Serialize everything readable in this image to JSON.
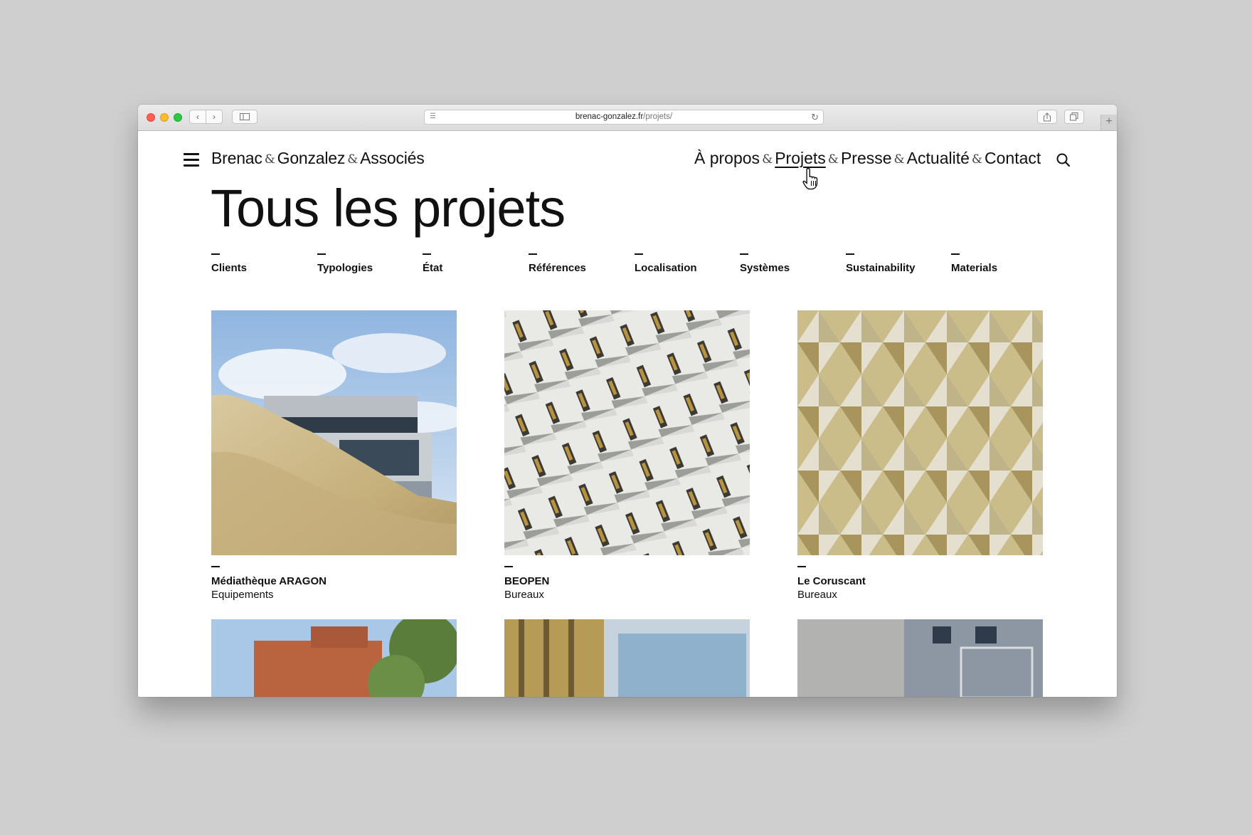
{
  "browser": {
    "url_domain": "brenac-gonzalez.fr",
    "url_path": "/projets/"
  },
  "header": {
    "brand_parts": [
      "Brenac",
      "Gonzalez",
      "Associés"
    ],
    "amp": "&",
    "nav": [
      "À propos",
      "Projets",
      "Presse",
      "Actualité",
      "Contact"
    ],
    "active_nav": "Projets"
  },
  "page": {
    "title": "Tous les projets"
  },
  "filters": [
    "Clients",
    "Typologies",
    "État",
    "Références",
    "Localisation",
    "Systèmes",
    "Sustainability",
    "Materials"
  ],
  "projects": [
    {
      "name": "Médiathèque ARAGON",
      "type": "Equipements"
    },
    {
      "name": "BEOPEN",
      "type": "Bureaux"
    },
    {
      "name": "Le Coruscant",
      "type": "Bureaux"
    }
  ]
}
